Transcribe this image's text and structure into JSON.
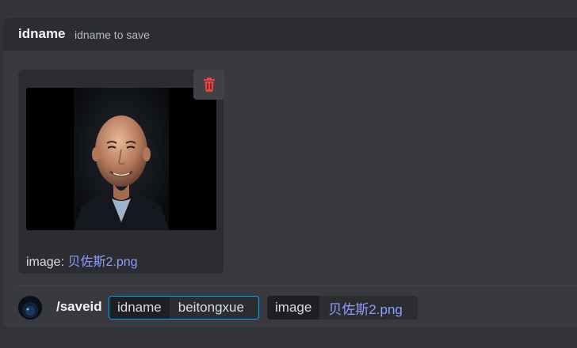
{
  "option_hint": {
    "name": "idname",
    "description": "idname to save"
  },
  "attachment": {
    "caption_label": "image: ",
    "filename": "贝佐斯2.png",
    "preview_alt": "portrait photo of a bald smiling man in a dark suit",
    "delete_icon": "trash-icon"
  },
  "command": {
    "name": "/saveid",
    "options": [
      {
        "key": "idname",
        "value": "beitongxue"
      },
      {
        "key": "image",
        "value": "贝佐斯2.png"
      }
    ]
  },
  "colors": {
    "background": "#313338",
    "panel": "#383a40",
    "accent_link": "#8c9cff",
    "delete_red": "#f23f43",
    "focus_border": "#00a8fc"
  }
}
